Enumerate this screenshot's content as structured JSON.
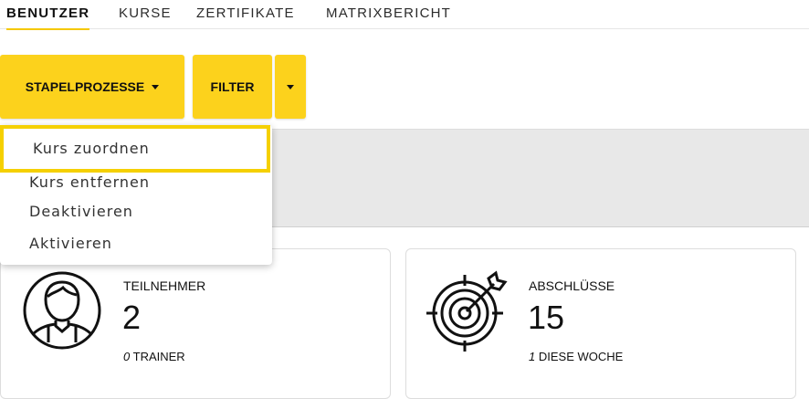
{
  "tabs": [
    {
      "label": "BENUTZER",
      "active": true
    },
    {
      "label": "KURSE",
      "active": false
    },
    {
      "label": "ZERTIFIKATE",
      "active": false
    },
    {
      "label": "MATRIXBERICHT",
      "active": false
    }
  ],
  "toolbar": {
    "batch_label": "STAPELPROZESSE",
    "filter_label": "FILTER"
  },
  "menu": {
    "items": [
      {
        "label": "Kurs zuordnen",
        "highlighted": true
      },
      {
        "label": "Kurs entfernen",
        "highlighted": false
      },
      {
        "label": "Deaktivieren",
        "highlighted": false
      },
      {
        "label": "Aktivieren",
        "highlighted": false
      }
    ]
  },
  "cards": {
    "participants": {
      "label": "TEILNEHMER",
      "value": "2",
      "sub_count": "0",
      "sub_label": "TRAINER",
      "icon": "user-icon"
    },
    "completions": {
      "label": "ABSCHLÜSSE",
      "value": "15",
      "sub_count": "1",
      "sub_label": "DIESE WOCHE",
      "icon": "target-icon"
    }
  },
  "colors": {
    "accent": "#fcd21c",
    "highlight_border": "#f5d000",
    "band": "#e8e8e8"
  }
}
